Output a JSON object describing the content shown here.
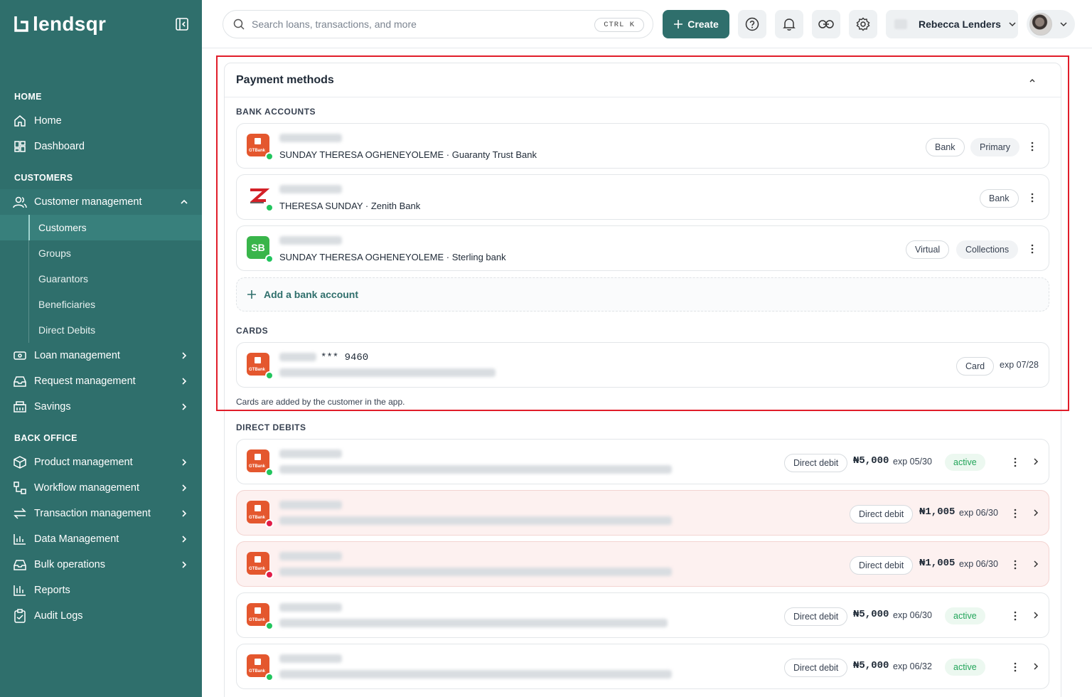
{
  "brand": {
    "name": "lendsqr"
  },
  "sidebar": {
    "sections": [
      {
        "title": "HOME"
      },
      {
        "title": "CUSTOMERS"
      },
      {
        "title": "BACK OFFICE"
      }
    ],
    "home_items": [
      {
        "label": "Home",
        "icon": "home-icon"
      },
      {
        "label": "Dashboard",
        "icon": "dashboard-icon"
      }
    ],
    "customer_management": {
      "label": "Customer management",
      "icon": "users-icon"
    },
    "customer_sub": [
      "Customers",
      "Groups",
      "Guarantors",
      "Beneficiaries",
      "Direct Debits"
    ],
    "customer_items": [
      {
        "label": "Loan management",
        "icon": "loan-icon"
      },
      {
        "label": "Request management",
        "icon": "inbox-icon"
      },
      {
        "label": "Savings",
        "icon": "savings-icon"
      }
    ],
    "backoffice_items": [
      {
        "label": "Product management",
        "icon": "box-icon"
      },
      {
        "label": "Workflow management",
        "icon": "workflow-icon"
      },
      {
        "label": "Transaction management",
        "icon": "arrows-icon"
      },
      {
        "label": "Data Management",
        "icon": "bar-chart-icon"
      },
      {
        "label": "Bulk operations",
        "icon": "inbox-icon"
      },
      {
        "label": "Reports",
        "icon": "report-icon"
      },
      {
        "label": "Audit Logs",
        "icon": "clipboard-icon"
      }
    ]
  },
  "topbar": {
    "search_placeholder": "Search loans, transactions, and more",
    "shortcut": "CTRL K",
    "create_label": "Create",
    "org_name": "Rebecca Lenders"
  },
  "payment_methods": {
    "title": "Payment methods",
    "bank_accounts_label": "BANK ACCOUNTS",
    "bank_accounts": [
      {
        "holder": "SUNDAY THERESA OGHENEYOLEME · Guaranty Trust Bank",
        "tags": [
          "Bank",
          "Primary"
        ],
        "logo": "gtbank"
      },
      {
        "holder": "THERESA SUNDAY · Zenith Bank",
        "tags": [
          "Bank"
        ],
        "logo": "zenith"
      },
      {
        "holder": "SUNDAY THERESA OGHENEYOLEME · Sterling bank",
        "tags": [
          "Virtual",
          "Collections"
        ],
        "logo": "SB"
      }
    ],
    "add_bank_label": "Add a bank account",
    "cards_label": "CARDS",
    "card": {
      "masked": "*** 9460",
      "tag": "Card",
      "expiry": "exp 07/28",
      "logo_text": "GTBank"
    },
    "cards_note": "Cards are added by the customer in the app.",
    "direct_debits_label": "DIRECT DEBITS",
    "direct_debits": [
      {
        "tag": "Direct debit",
        "amount": "₦5,000",
        "expiry": "exp 05/30",
        "status": "active",
        "state": "ok"
      },
      {
        "tag": "Direct debit",
        "amount": "₦1,005",
        "expiry": "exp 06/30",
        "status": "",
        "state": "error"
      },
      {
        "tag": "Direct debit",
        "amount": "₦1,005",
        "expiry": "exp 06/30",
        "status": "",
        "state": "error"
      },
      {
        "tag": "Direct debit",
        "amount": "₦5,000",
        "expiry": "exp 06/30",
        "status": "active",
        "state": "ok"
      },
      {
        "tag": "Direct debit",
        "amount": "₦5,000",
        "expiry": "exp 06/32",
        "status": "active",
        "state": "ok"
      }
    ]
  },
  "colors": {
    "brand": "#2f6f6c",
    "danger_bg": "#fdf1f0",
    "active": "#22a55a",
    "highlight": "#e11d2a"
  }
}
